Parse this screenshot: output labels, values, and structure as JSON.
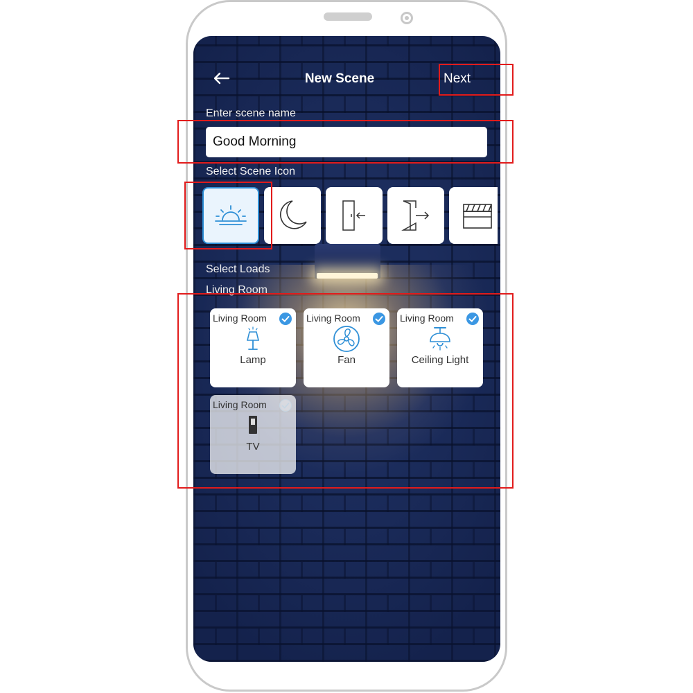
{
  "header": {
    "back_label": "←",
    "title": "New Scene",
    "next_label": "Next"
  },
  "scene_name": {
    "label": "Enter scene name",
    "value": "Good Morning"
  },
  "scene_icons": {
    "label": "Select Scene Icon",
    "items": [
      {
        "icon": "sunrise-icon",
        "selected": true
      },
      {
        "icon": "moon-icon",
        "selected": false
      },
      {
        "icon": "door-enter-icon",
        "selected": false
      },
      {
        "icon": "door-exit-icon",
        "selected": false
      },
      {
        "icon": "clapperboard-icon",
        "selected": false
      }
    ]
  },
  "loads": {
    "label": "Select Loads",
    "room_label": "Living Room",
    "items": [
      {
        "room": "Living Room",
        "name": "Lamp",
        "icon": "lamp-icon",
        "checked": true
      },
      {
        "room": "Living Room",
        "name": "Fan",
        "icon": "fan-icon",
        "checked": true
      },
      {
        "room": "Living Room",
        "name": "Ceiling Light",
        "icon": "ceiling-light-icon",
        "checked": true
      },
      {
        "room": "Living Room",
        "name": "TV",
        "icon": "tv-icon",
        "checked": false
      }
    ]
  },
  "colors": {
    "accent": "#3b97e3",
    "highlight": "#e21b1b",
    "background": "#1c2d5d"
  }
}
